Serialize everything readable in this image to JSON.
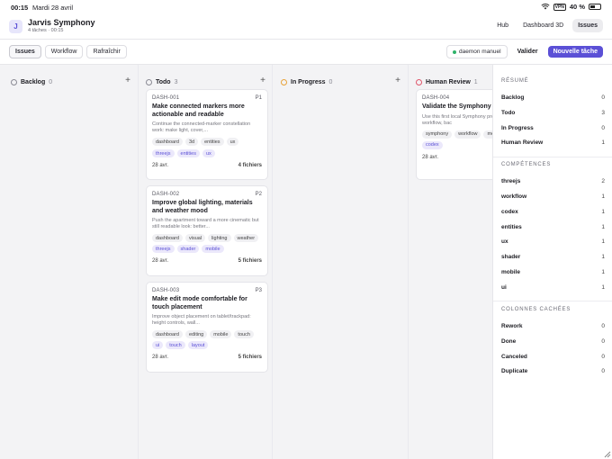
{
  "statusbar": {
    "time": "00:15",
    "date": "Mardi 28 avril",
    "vpn": "VPN",
    "battery": "40 %"
  },
  "header": {
    "avatar": "J",
    "title": "Jarvis Symphony",
    "subtitle": "4 tâches · 00:15",
    "nav": [
      {
        "label": "Hub",
        "active": false
      },
      {
        "label": "Dashboard 3D",
        "active": false
      },
      {
        "label": "Issues",
        "active": true
      }
    ]
  },
  "toolbar": {
    "left": [
      "Issues",
      "Workflow",
      "Rafraîchir"
    ],
    "daemon": "daemon manuel",
    "valider": "Valider",
    "new_task": "Nouvelle tâche"
  },
  "columns": [
    {
      "name": "Backlog",
      "count": "0"
    },
    {
      "name": "Todo",
      "count": "3"
    },
    {
      "name": "In Progress",
      "count": "0"
    },
    {
      "name": "Human Review",
      "count": "1"
    }
  ],
  "cards": [
    {
      "id": "DASH-001",
      "priority": "P1",
      "title": "Make connected markers more actionable and readable",
      "desc": "Continue the connected-marker constellation work: make light, cover,...",
      "tags": [
        "dashboard",
        "3d",
        "entities",
        "ux"
      ],
      "skills": [
        "threejs",
        "entities",
        "ux"
      ],
      "date": "28 avr.",
      "files": "4 fichiers"
    },
    {
      "id": "DASH-002",
      "priority": "P2",
      "title": "Improve global lighting, materials and weather mood",
      "desc": "Push the apartment toward a more cinematic but still readable look: better...",
      "tags": [
        "dashboard",
        "visual",
        "lighting",
        "weather"
      ],
      "skills": [
        "threejs",
        "shader",
        "mobile"
      ],
      "date": "28 avr.",
      "files": "5 fichiers"
    },
    {
      "id": "DASH-003",
      "priority": "P3",
      "title": "Make edit mode comfortable for touch placement",
      "desc": "Improve object placement on tablet/trackpad: height controls, wall...",
      "tags": [
        "dashboard",
        "editing",
        "mobile",
        "touch"
      ],
      "skills": [
        "ui",
        "touch",
        "layout"
      ],
      "date": "28 avr.",
      "files": "5 fichiers"
    },
    {
      "id": "DASH-004",
      "priority": "",
      "title": "Validate the Symphony lab itself",
      "desc": "Use this first local Symphony prove that the workflow, bac",
      "tags": [
        "symphony",
        "workflow",
        "meta"
      ],
      "skills": [
        "workflow",
        "codex"
      ],
      "date": "28 avr.",
      "files": ""
    }
  ],
  "summary": {
    "resume_title": "RÉSUMÉ",
    "resume": [
      {
        "label": "Backlog",
        "value": "0"
      },
      {
        "label": "Todo",
        "value": "3"
      },
      {
        "label": "In Progress",
        "value": "0"
      },
      {
        "label": "Human Review",
        "value": "1"
      }
    ],
    "skills_title": "COMPÉTENCES",
    "skills": [
      {
        "label": "threejs",
        "value": "2"
      },
      {
        "label": "workflow",
        "value": "1"
      },
      {
        "label": "codex",
        "value": "1"
      },
      {
        "label": "entities",
        "value": "1"
      },
      {
        "label": "ux",
        "value": "1"
      },
      {
        "label": "shader",
        "value": "1"
      },
      {
        "label": "mobile",
        "value": "1"
      },
      {
        "label": "ui",
        "value": "1"
      }
    ],
    "hidden_title": "COLONNES CACHÉES",
    "hidden": [
      {
        "label": "Rework",
        "value": "0"
      },
      {
        "label": "Done",
        "value": "0"
      },
      {
        "label": "Canceled",
        "value": "0"
      },
      {
        "label": "Duplicate",
        "value": "0"
      }
    ]
  },
  "colors": {
    "accent": "#5b50d6",
    "todo": "#8a8a94",
    "in_progress": "#e8a33a",
    "human_review": "#e0566b",
    "daemon_dot": "#2fb36a"
  }
}
